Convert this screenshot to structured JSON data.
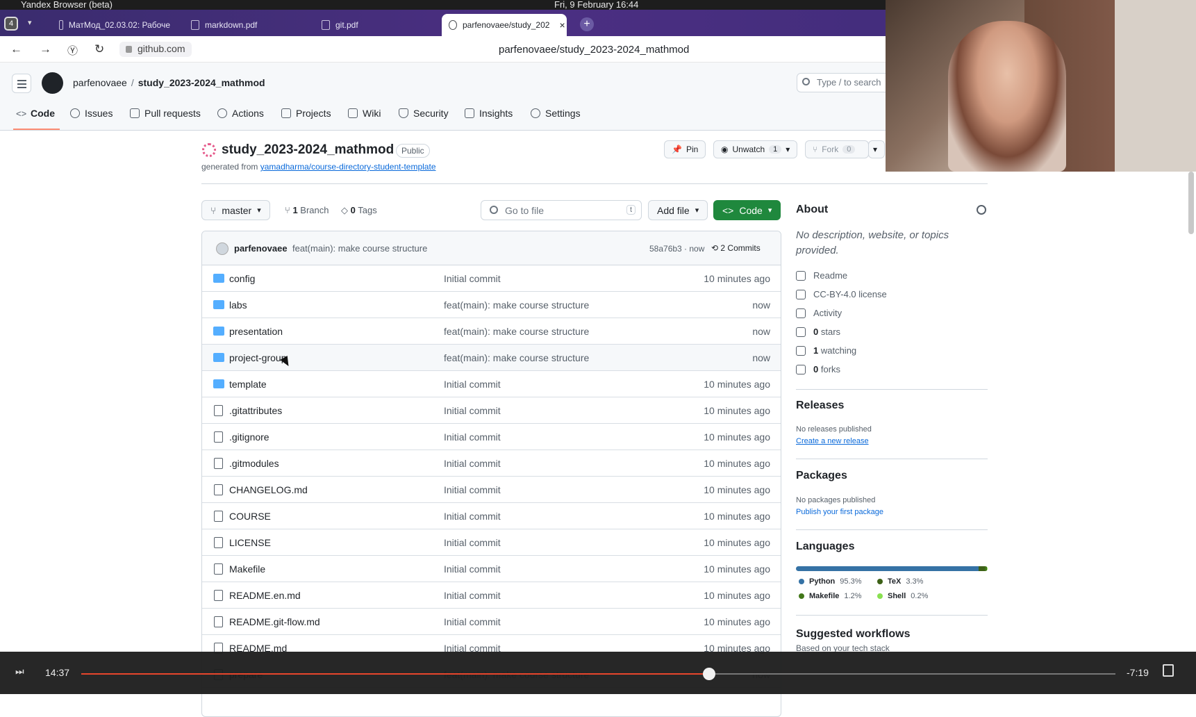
{
  "os": {
    "app_name": "Yandex Browser (beta)",
    "clock": "Fri, 9 February  16:44"
  },
  "browser": {
    "tab_count": "4",
    "tabs": [
      {
        "label": "МатМод_02.03.02: Рабоче"
      },
      {
        "label": "markdown.pdf"
      },
      {
        "label": "git.pdf"
      },
      {
        "label": "parfenovaee/study_202"
      }
    ],
    "domain": "github.com",
    "page_title": "parfenovaee/study_2023-2024_mathmod"
  },
  "header": {
    "owner": "parfenovaee",
    "separator": "/",
    "repo": "study_2023-2024_mathmod",
    "search_placeholder": "Type / to search"
  },
  "repo_nav": [
    {
      "label": "Code"
    },
    {
      "label": "Issues"
    },
    {
      "label": "Pull requests"
    },
    {
      "label": "Actions"
    },
    {
      "label": "Projects"
    },
    {
      "label": "Wiki"
    },
    {
      "label": "Security"
    },
    {
      "label": "Insights"
    },
    {
      "label": "Settings"
    }
  ],
  "repo": {
    "name": "study_2023-2024_mathmod",
    "visibility": "Public",
    "generated_prefix": "generated from ",
    "template_link": "yamadharma/course-directory-student-template",
    "pin_label": "Pin",
    "unwatch_label": "Unwatch",
    "watch_count": "1",
    "fork_label": "Fork",
    "fork_count": "0"
  },
  "toolbar": {
    "branch": "master",
    "branch_count": "1",
    "branch_label": "Branch",
    "tag_count": "0",
    "tag_label": "Tags",
    "goto_placeholder": "Go to file",
    "goto_key": "t",
    "add_file": "Add file",
    "code": "Code"
  },
  "last_commit": {
    "author": "parfenovaee",
    "message": "feat(main): make course structure",
    "hash_time": "58a76b3 · now",
    "commits": "2 Commits"
  },
  "files": [
    {
      "name": "config",
      "type": "dir",
      "message": "Initial commit",
      "date": "10 minutes ago"
    },
    {
      "name": "labs",
      "type": "dir",
      "message": "feat(main): make course structure",
      "date": "now"
    },
    {
      "name": "presentation",
      "type": "dir",
      "message": "feat(main): make course structure",
      "date": "now"
    },
    {
      "name": "project-group",
      "type": "dir",
      "message": "feat(main): make course structure",
      "date": "now"
    },
    {
      "name": "template",
      "type": "dir",
      "message": "Initial commit",
      "date": "10 minutes ago"
    },
    {
      "name": ".gitattributes",
      "type": "file",
      "message": "Initial commit",
      "date": "10 minutes ago"
    },
    {
      "name": ".gitignore",
      "type": "file",
      "message": "Initial commit",
      "date": "10 minutes ago"
    },
    {
      "name": ".gitmodules",
      "type": "file",
      "message": "Initial commit",
      "date": "10 minutes ago"
    },
    {
      "name": "CHANGELOG.md",
      "type": "file",
      "message": "Initial commit",
      "date": "10 minutes ago"
    },
    {
      "name": "COURSE",
      "type": "file",
      "message": "Initial commit",
      "date": "10 minutes ago"
    },
    {
      "name": "LICENSE",
      "type": "file",
      "message": "Initial commit",
      "date": "10 minutes ago"
    },
    {
      "name": "Makefile",
      "type": "file",
      "message": "Initial commit",
      "date": "10 minutes ago"
    },
    {
      "name": "README.en.md",
      "type": "file",
      "message": "Initial commit",
      "date": "10 minutes ago"
    },
    {
      "name": "README.git-flow.md",
      "type": "file",
      "message": "Initial commit",
      "date": "10 minutes ago"
    },
    {
      "name": "README.md",
      "type": "file",
      "message": "Initial commit",
      "date": "10 minutes ago"
    },
    {
      "name": "prepare",
      "type": "file",
      "message": "feat(main): make course structure",
      "date": "now"
    }
  ],
  "about": {
    "title": "About",
    "description": "No description, website, or topics provided.",
    "items": [
      {
        "icon": "book-icon",
        "count": "",
        "label": "Readme"
      },
      {
        "icon": "scale-icon",
        "count": "",
        "label": "CC-BY-4.0 license"
      },
      {
        "icon": "pulse-icon",
        "count": "",
        "label": "Activity"
      },
      {
        "icon": "star-icon",
        "count": "0",
        "label": " stars"
      },
      {
        "icon": "eye-icon",
        "count": "1",
        "label": " watching"
      },
      {
        "icon": "fork-icon",
        "count": "0",
        "label": " forks"
      }
    ]
  },
  "releases": {
    "title": "Releases",
    "none": "No releases published",
    "link": "Create a new release"
  },
  "packages": {
    "title": "Packages",
    "none": "No packages published",
    "link": "Publish your first package"
  },
  "languages": {
    "title": "Languages",
    "items": [
      {
        "name": "Python",
        "percent": "95.3%",
        "share": 95.3,
        "color": "#3572A5"
      },
      {
        "name": "TeX",
        "percent": "3.3%",
        "share": 3.3,
        "color": "#3D6117"
      },
      {
        "name": "Makefile",
        "percent": "1.2%",
        "share": 1.2,
        "color": "#427819"
      },
      {
        "name": "Shell",
        "percent": "0.2%",
        "share": 0.2,
        "color": "#89e051"
      }
    ]
  },
  "workflows": {
    "title": "Suggested workflows",
    "subtitle": "Based on your tech stack"
  },
  "player": {
    "elapsed": "14:37",
    "remaining": "-7:19",
    "progress": 0.607
  }
}
